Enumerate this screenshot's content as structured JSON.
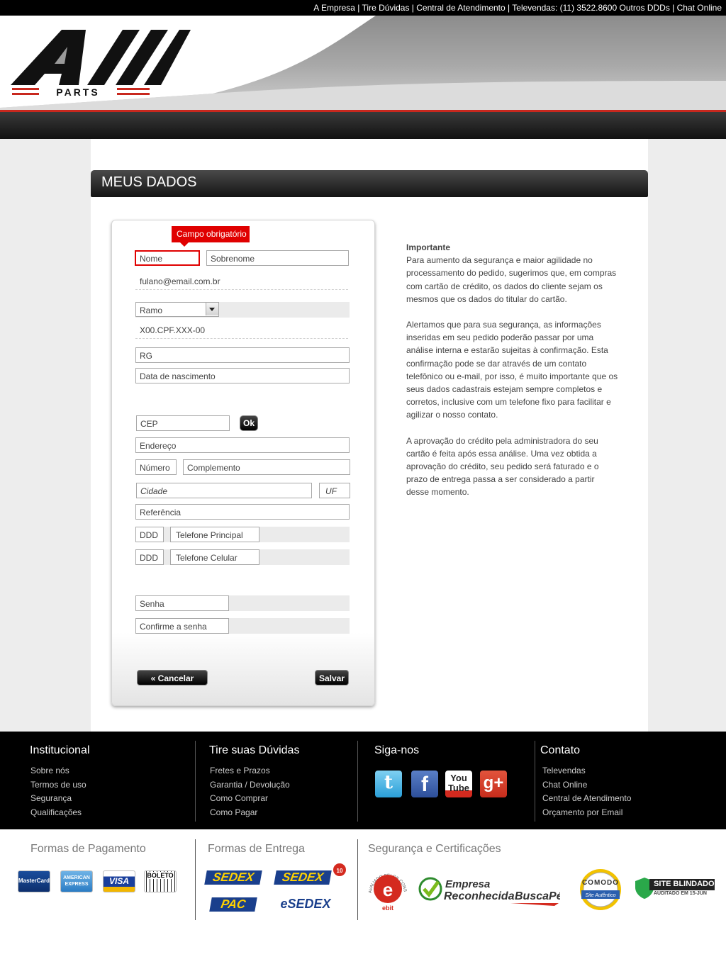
{
  "topbar": {
    "links": [
      "A Empresa",
      "Tire Dúvidas",
      "Central de Atendimento",
      "Televendas: (11) 3522.8600 Outros DDDs",
      "Chat Online"
    ]
  },
  "logo": {
    "text": "PARTS",
    "label": "All Parts"
  },
  "section": {
    "title": "MEUS DADOS"
  },
  "form": {
    "tooltip": "Campo obrigatório",
    "nome": "Nome",
    "sobrenome": "Sobrenome",
    "email": "fulano@email.com.br",
    "ramo": "Ramo",
    "cpf": "X00.CPF.XXX-00",
    "rg": "RG",
    "nascimento": "Data de nascimento",
    "cep": "CEP",
    "ok": "Ok",
    "endereco": "Endereço",
    "numero": "Número",
    "complemento": "Complemento",
    "cidade": "Cidade",
    "uf": "UF",
    "referencia": "Referência",
    "ddd1": "DDD",
    "telefone": "Telefone Principal",
    "ddd2": "DDD",
    "celular": "Telefone Celular",
    "senha": "Senha",
    "confirme": "Confirme a senha",
    "cancelar": "« Cancelar",
    "salvar": "Salvar"
  },
  "info": {
    "title": "Importante",
    "p1": "Para aumento da segurança e maior agilidade no processamento do pedido, sugerimos que, em compras com cartão de crédito, os dados do cliente sejam os mesmos que os dados do titular do cartão.",
    "p2": "Alertamos que para sua segurança, as informações inseridas em seu pedido poderão passar por uma análise interna e estarão sujeitas à confirmação. Esta confirmação pode se dar através de um contato telefônico ou e-mail, por isso, é muito importante que os seus dados cadastrais estejam sempre completos e corretos, inclusive com um telefone fixo para facilitar e agilizar o nosso contato.",
    "p3": "A aprovação do crédito pela administradora do seu cartão é feita após essa análise. Uma vez obtida a aprovação do crédito, seu pedido será faturado e o prazo de entrega passa a ser considerado a partir desse momento."
  },
  "footer": {
    "institucional": {
      "title": "Institucional",
      "items": [
        "Sobre nós",
        "Termos de uso",
        "Segurança",
        "Qualificações"
      ]
    },
    "duvidas": {
      "title": "Tire suas Dúvidas",
      "items": [
        "Fretes e Prazos",
        "Garantia / Devolução",
        "Como Comprar",
        "Como Pagar"
      ]
    },
    "siga": {
      "title": "Siga-nos",
      "twitter": "t",
      "facebook": "f",
      "youtube": "You Tube",
      "gplus": "g+"
    },
    "contato": {
      "title": "Contato",
      "items": [
        "Televendas",
        "Chat Online",
        "Central de Atendimento",
        "Orçamento por Email"
      ]
    }
  },
  "footer2": {
    "pagamento": {
      "title": "Formas de Pagamento",
      "cards": [
        "MasterCard",
        "AMERICAN EXPRESS",
        "VISA",
        "BOLETO"
      ]
    },
    "entrega": {
      "title": "Formas de Entrega",
      "items": [
        "SEDEX",
        "SEDEX",
        "PAC",
        "eSEDEX"
      ],
      "badge": "10"
    },
    "seguranca": {
      "title": "Segurança e Certificações",
      "ebit": "e",
      "ebit_name": "ebit",
      "ebit_ring": "AVALIADO PELOS CONSUMIDORES",
      "buscape_1": "Empresa",
      "buscape_2": "Reconhecida",
      "buscape_3": "BuscaPé",
      "comodo": "COMODO",
      "comodo_sub": "Site Autêntico",
      "blindado": "SITE BLINDADO",
      "blindado_sub": "AUDITADO EM 15-JUN"
    }
  },
  "colors": {
    "required": "#e00000",
    "accent_red": "#c8281e"
  }
}
